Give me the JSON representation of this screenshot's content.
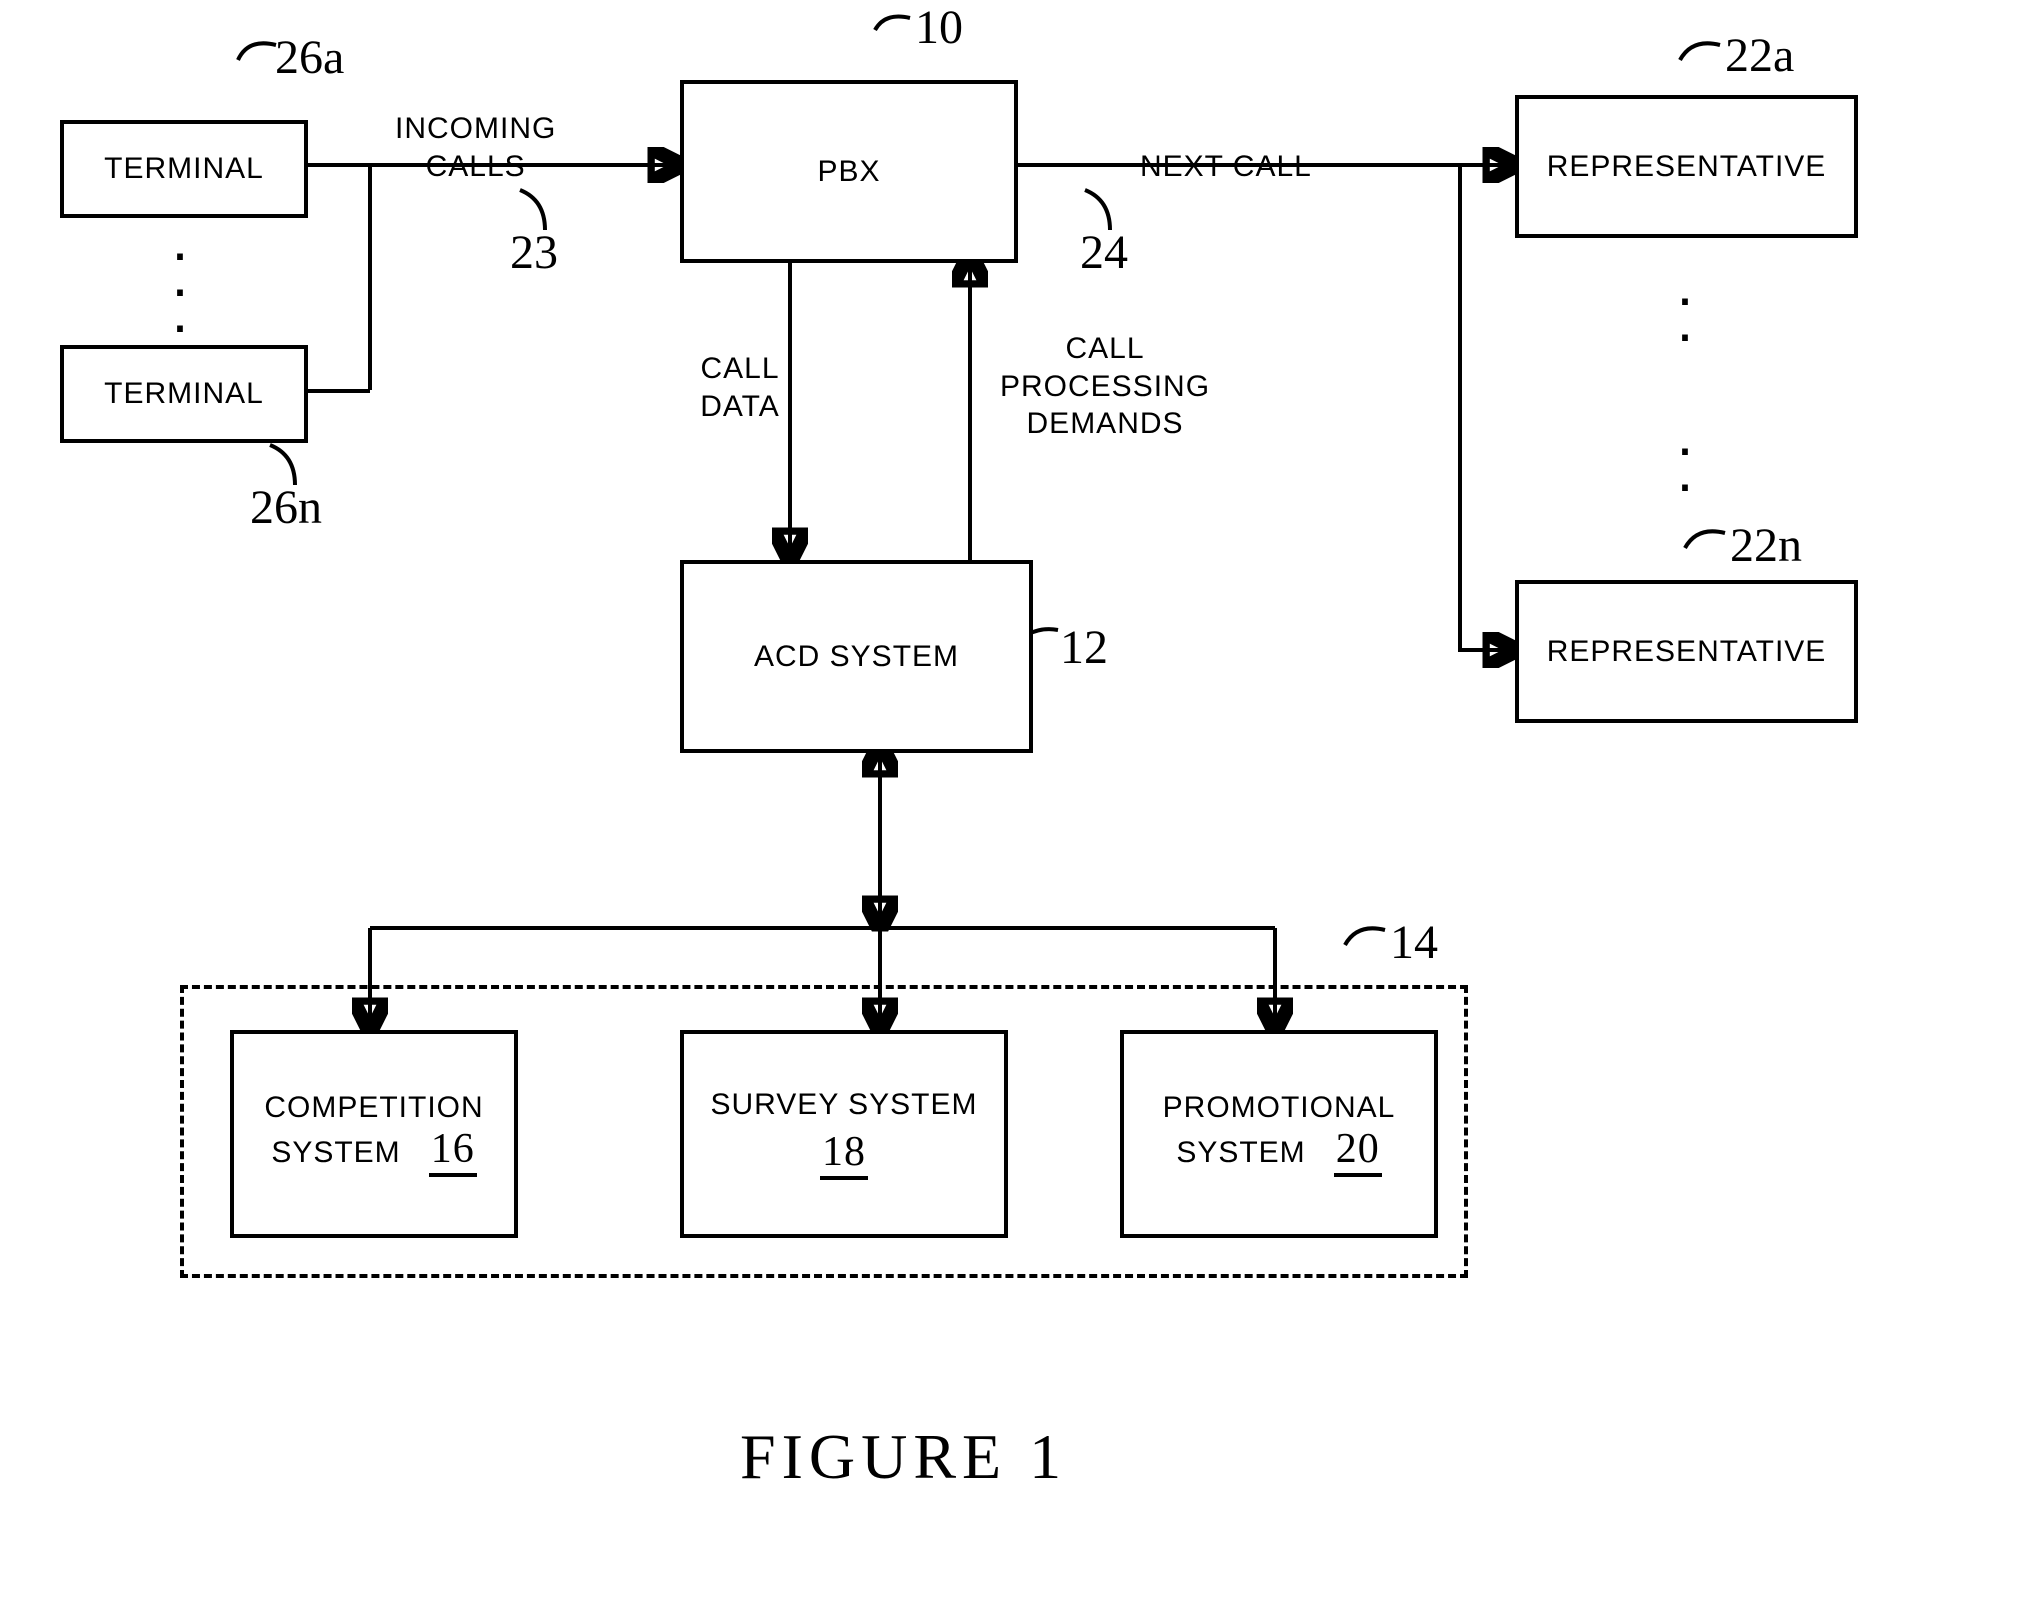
{
  "boxes": {
    "terminal_a": "TERMINAL",
    "terminal_n": "TERMINAL",
    "pbx": "PBX",
    "rep_a": "REPRESENTATIVE",
    "rep_n": "REPRESENTATIVE",
    "acd": "ACD SYSTEM",
    "competition_l1": "COMPETITION",
    "competition_l2": "SYSTEM",
    "survey": "SURVEY SYSTEM",
    "promo_l1": "PROMOTIONAL",
    "promo_l2": "SYSTEM"
  },
  "labels": {
    "incoming_calls": "INCOMING\nCALLS",
    "next_call": "NEXT CALL",
    "call_data": "CALL\nDATA",
    "call_proc": "CALL\nPROCESSING\nDEMANDS"
  },
  "refs": {
    "r10": "10",
    "r22a": "22a",
    "r22n": "22n",
    "r26a": "26a",
    "r26n": "26n",
    "r23": "23",
    "r24": "24",
    "r12": "12",
    "r14": "14",
    "r16": "16",
    "r18": "18",
    "r20": "20"
  },
  "figure_caption": "FIGURE  1"
}
